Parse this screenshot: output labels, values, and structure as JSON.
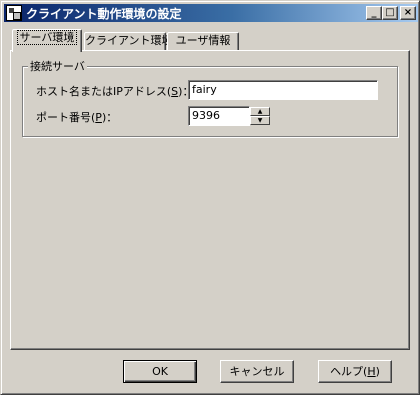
{
  "window": {
    "title": "クライアント動作環境の設定",
    "minimize_glyph": "_",
    "maximize_glyph": "□",
    "close_glyph": "×"
  },
  "tabs": [
    {
      "label": "サーバ環境",
      "active": true
    },
    {
      "label": "クライアント環境",
      "active": false
    },
    {
      "label": "ユーザ情報",
      "active": false
    }
  ],
  "group": {
    "title": "接続サーバ",
    "host": {
      "label_pre": "ホスト名またはIPアドレス(",
      "label_key": "S",
      "label_post": ")：",
      "value": "fairy"
    },
    "port": {
      "label_pre": "ポート番号(",
      "label_key": "P",
      "label_post": ")：",
      "value": "9396",
      "up_glyph": "▲",
      "down_glyph": "▼"
    }
  },
  "buttons": {
    "ok": "OK",
    "cancel": "キャンセル",
    "help_pre": "ヘルプ(",
    "help_key": "H",
    "help_post": ")"
  }
}
